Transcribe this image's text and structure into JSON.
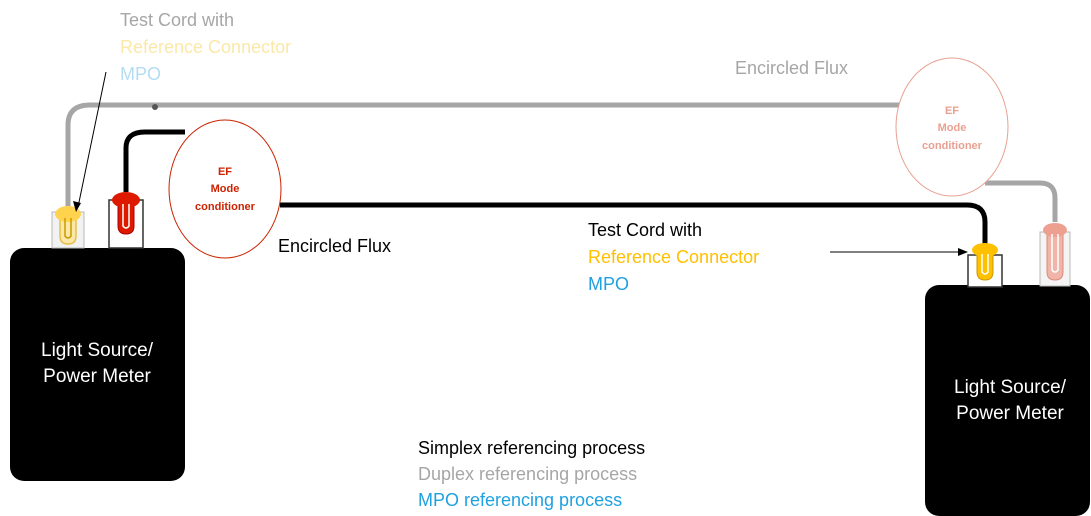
{
  "colors": {
    "gray": "#a6a6a6",
    "yellow": "#ffc000",
    "pale_yellow": "#fbe8a6",
    "blue": "#1fa1e0",
    "pale_blue": "#b4ddf3",
    "red": "#cc2200",
    "pale_red": "#e8a090",
    "black": "#000000"
  },
  "top_left_label": {
    "line1": "Test Cord with",
    "line2": "Reference Connector",
    "line3": "MPO"
  },
  "encircled_flux_top": "Encircled Flux",
  "encircled_flux_mid": "Encircled Flux",
  "ef_left": {
    "line1": "EF",
    "line2": "Mode",
    "line3": "conditioner"
  },
  "ef_right": {
    "line1": "EF",
    "line2": "Mode",
    "line3": "conditioner"
  },
  "mid_label": {
    "line1": "Test Cord with",
    "line2": "Reference Connector",
    "line3": "MPO"
  },
  "left_device": {
    "line1": "Light Source/",
    "line2": "Power Meter"
  },
  "right_device": {
    "line1": "Light Source/",
    "line2": "Power Meter"
  },
  "legend": {
    "simplex": "Simplex referencing process",
    "duplex": "Duplex referencing process",
    "mpo": "MPO referencing process"
  }
}
